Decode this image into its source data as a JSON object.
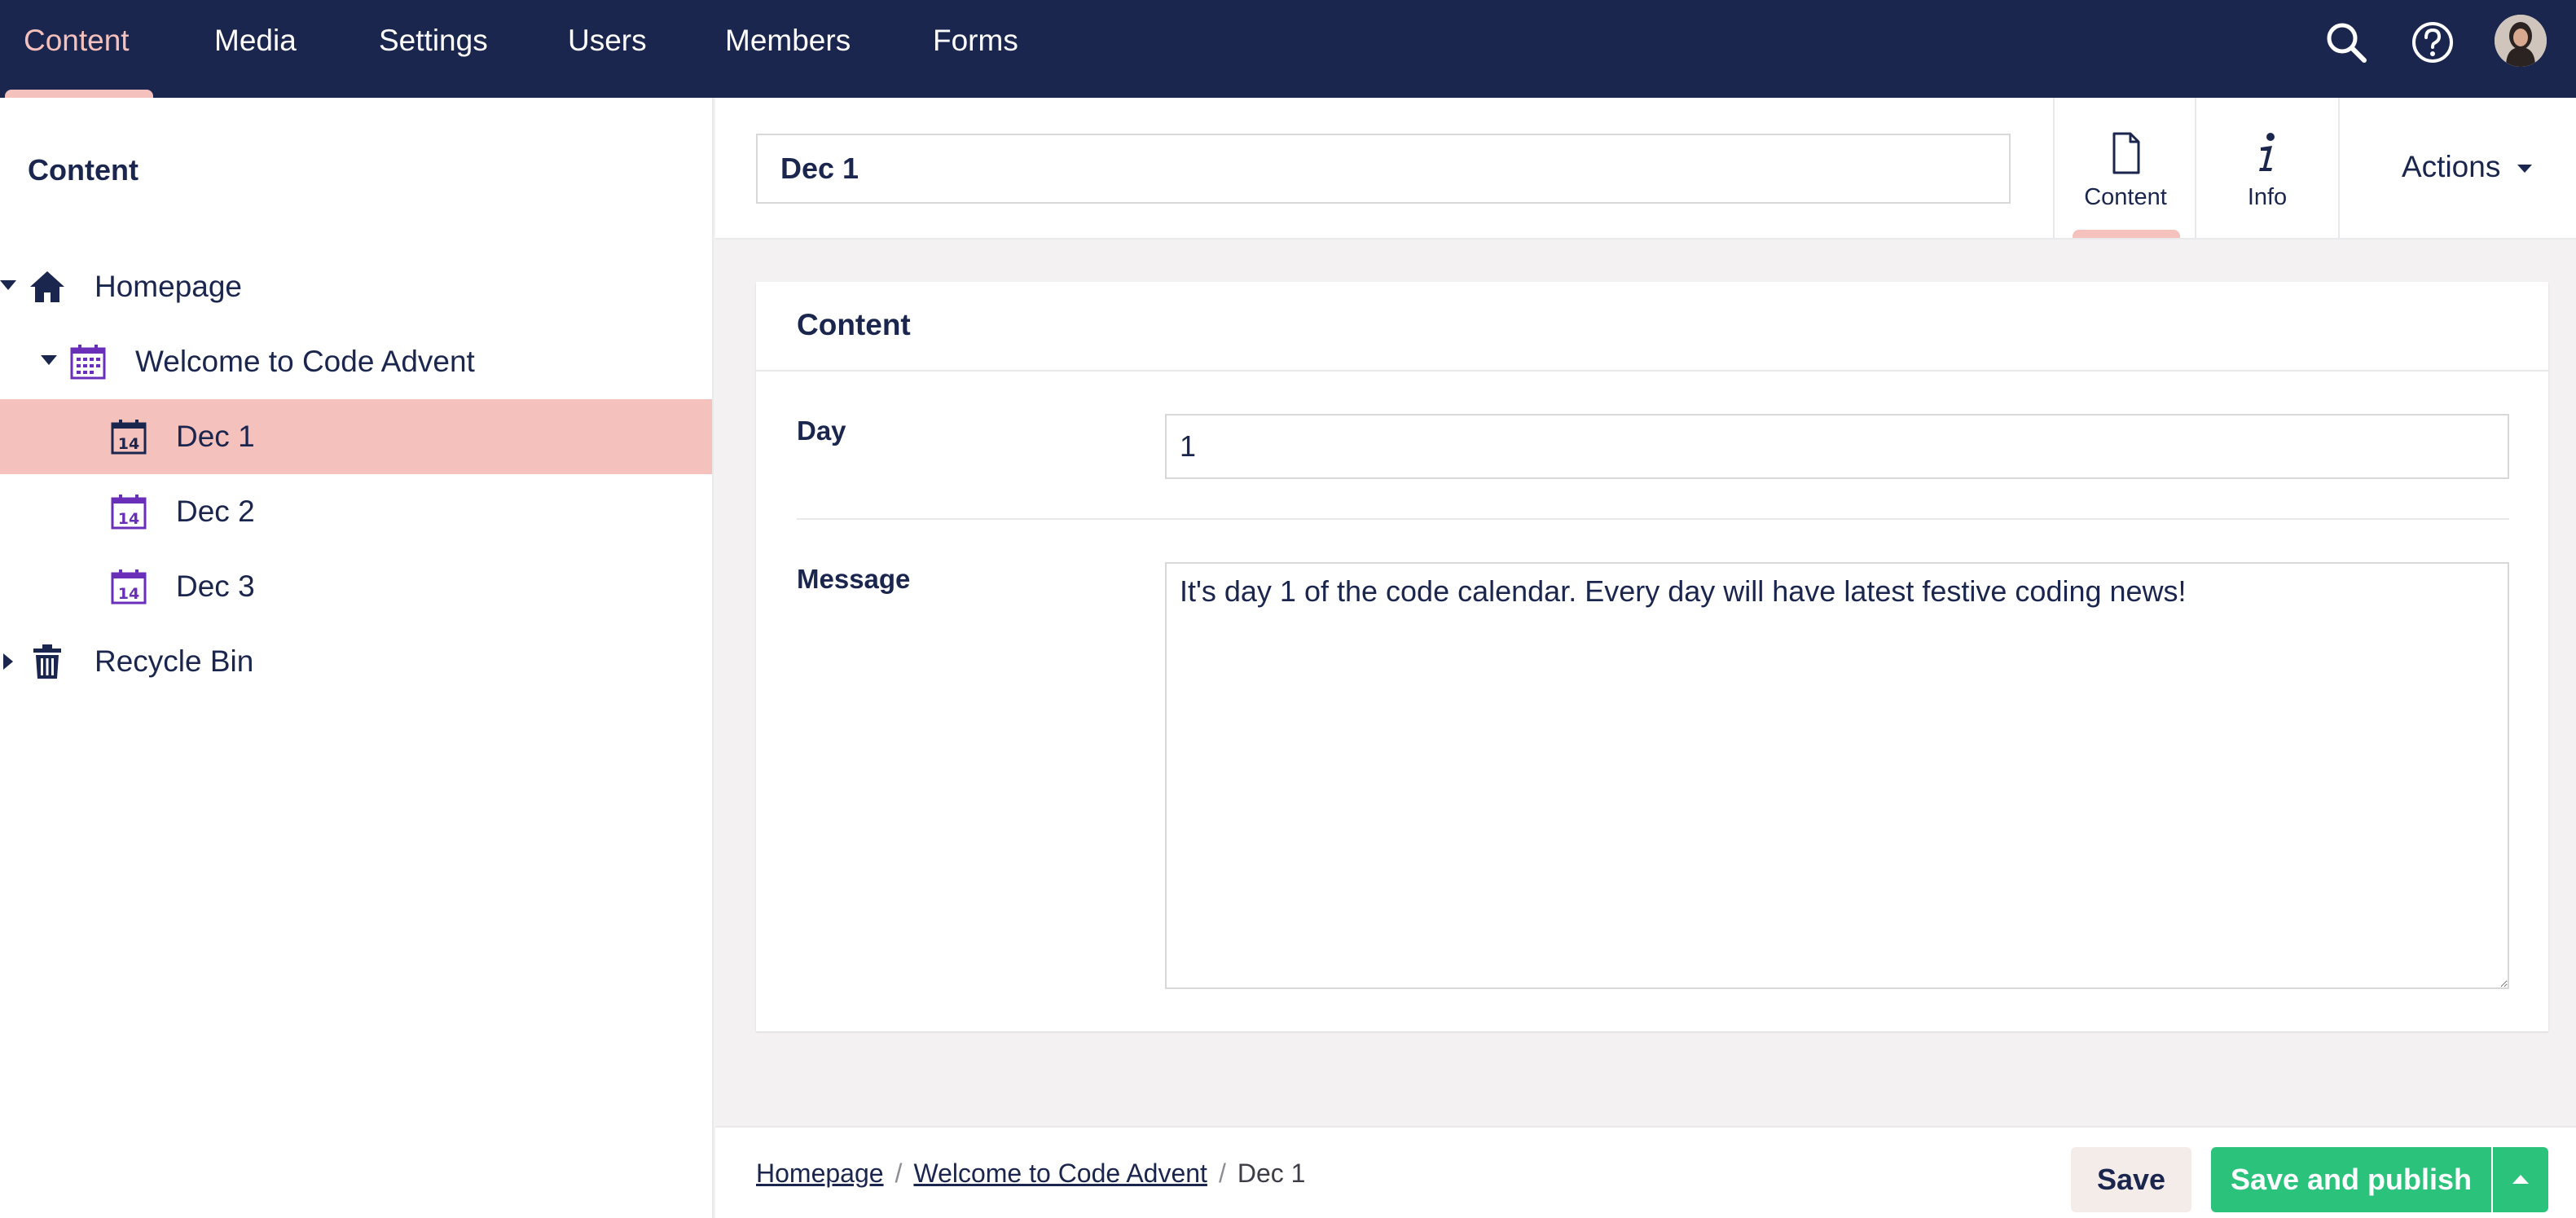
{
  "colors": {
    "nav_bg": "#1b264f",
    "nav_active": "#f5c1bc",
    "selected_row": "#f5c1bc",
    "publish_green": "#2bc37c",
    "calendar_icon": "#6a2fb8"
  },
  "topnav": {
    "sections": [
      "Content",
      "Media",
      "Settings",
      "Users",
      "Members",
      "Forms"
    ],
    "active": "Content",
    "icons": [
      "search-icon",
      "help-icon",
      "avatar"
    ]
  },
  "sidebar": {
    "title": "Content",
    "tree": [
      {
        "label": "Homepage",
        "icon": "home-icon",
        "expanded": true
      },
      {
        "label": "Welcome to Code Advent",
        "icon": "calendar-icon",
        "expanded": true
      },
      {
        "label": "Dec 1",
        "icon": "calendar-day-icon",
        "selected": true
      },
      {
        "label": "Dec 2",
        "icon": "calendar-day-icon"
      },
      {
        "label": "Dec 3",
        "icon": "calendar-day-icon"
      },
      {
        "label": "Recycle Bin",
        "icon": "trash-icon",
        "expanded": false
      }
    ]
  },
  "editor": {
    "name_value": "Dec 1",
    "apps": [
      {
        "label": "Content",
        "icon": "document-icon",
        "active": true
      },
      {
        "label": "Info",
        "icon": "info-icon"
      }
    ],
    "actions_label": "Actions"
  },
  "panel": {
    "title": "Content",
    "day_label": "Day",
    "day_value": "1",
    "message_label": "Message",
    "message_value": "It's day 1 of the code calendar. Every day will have latest festive coding news!"
  },
  "footer": {
    "breadcrumb": [
      "Homepage",
      "Welcome to Code Advent",
      "Dec 1"
    ],
    "save_label": "Save",
    "publish_label": "Save and publish"
  }
}
